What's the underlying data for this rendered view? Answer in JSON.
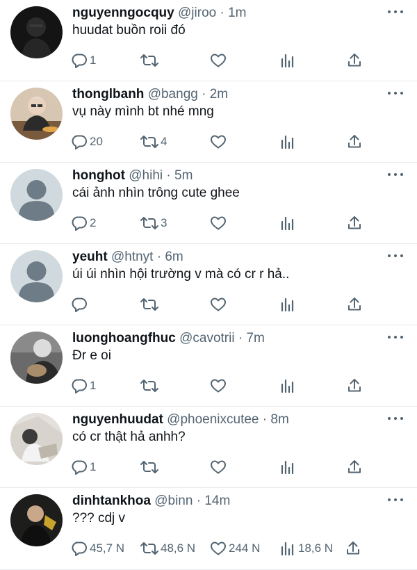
{
  "tweets": [
    {
      "name": "nguyenngocquy",
      "handle": "@jiroo",
      "time": "1m",
      "text": "huudat buồn roii đó",
      "replies": "1",
      "retweets": "",
      "likes": "",
      "views": ""
    },
    {
      "name": "thonglbanh",
      "handle": "@bangg",
      "time": "2m",
      "text": "vụ này mình bt nhé mng",
      "replies": "20",
      "retweets": "4",
      "likes": "",
      "views": ""
    },
    {
      "name": "honghot",
      "handle": "@hihi",
      "time": "5m",
      "text": "cái ảnh nhìn trông cute ghee",
      "replies": "2",
      "retweets": "3",
      "likes": "",
      "views": ""
    },
    {
      "name": "yeuht",
      "handle": "@htnyt",
      "time": "6m",
      "text": "úi úi nhìn hội trường v mà có cr r hả..",
      "replies": "",
      "retweets": "",
      "likes": "",
      "views": ""
    },
    {
      "name": "luonghoangfhuc",
      "handle": "@cavotrii",
      "time": "7m",
      "text": "Đr e oi",
      "replies": "1",
      "retweets": "",
      "likes": "",
      "views": ""
    },
    {
      "name": "nguyenhuudat",
      "handle": "@phoenixcutee",
      "time": "8m",
      "text": "có cr thật hả anhh?",
      "replies": "1",
      "retweets": "",
      "likes": "",
      "views": ""
    },
    {
      "name": "dinhtankhoa",
      "handle": "@binn",
      "time": "14m",
      "text": "??? cdj v",
      "replies": "45,7 N",
      "retweets": "48,6 N",
      "likes": "244 N",
      "views": "18,6 N"
    }
  ],
  "separator": "·",
  "icons": [
    "reply-icon",
    "retweet-icon",
    "heart-icon",
    "stats-icon",
    "share-icon",
    "more-icon"
  ],
  "colors": {
    "text": "#0f1419",
    "secondary": "#536471",
    "divider": "#e7e9ea",
    "default_avatar_bg": "#cfd9de",
    "default_avatar_fg": "#6e7c87"
  }
}
